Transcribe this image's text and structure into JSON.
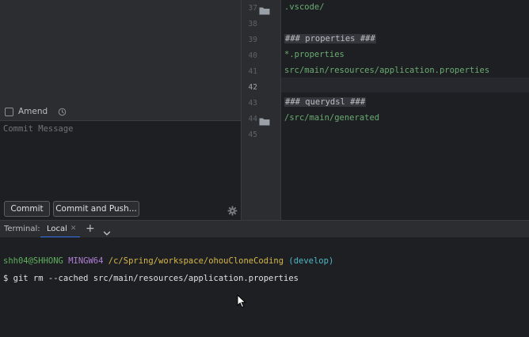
{
  "commit_panel": {
    "amend_label": "Amend",
    "message_placeholder": "Commit Message",
    "commit_button": "Commit",
    "commit_push_button": "Commit and Push..."
  },
  "editor": {
    "lines": [
      {
        "no": "37",
        "text": ".vscode/",
        "style": "green",
        "folder": true
      },
      {
        "no": "38",
        "text": "",
        "style": "green",
        "folder": false
      },
      {
        "no": "39",
        "text": "### properties ###",
        "style": "heading",
        "folder": false
      },
      {
        "no": "40",
        "text": "*.properties",
        "style": "green",
        "folder": false
      },
      {
        "no": "41",
        "text": "src/main/resources/application.properties",
        "style": "green",
        "folder": false
      },
      {
        "no": "42",
        "text": "",
        "style": "green",
        "folder": false
      },
      {
        "no": "43",
        "text": "### querydsl ###",
        "style": "heading",
        "folder": false
      },
      {
        "no": "44",
        "text": "/src/main/generated",
        "style": "green",
        "folder": true
      },
      {
        "no": "45",
        "text": "",
        "style": "green",
        "folder": false
      }
    ],
    "current_line": "42"
  },
  "terminal": {
    "title": "Terminal:",
    "tab_label": "Local",
    "prompt": {
      "user": "shh04@SHHONG",
      "host": "MINGW64",
      "path": "/c/Spring/workspace/ohouCloneCoding",
      "branch": "(develop)"
    },
    "command": "$ git rm --cached src/main/resources/application.properties"
  },
  "colors": {
    "accent": "#3574f0",
    "code_green": "#6aab73",
    "prompt_user": "#5fb05f",
    "prompt_host": "#b07fd6",
    "prompt_path": "#d7b84a",
    "prompt_branch": "#4fb7c7"
  },
  "icons": {
    "history": "clock-icon",
    "settings": "gear-icon",
    "folder": "folder-icon",
    "new_tab": "plus-icon",
    "tab_menu": "chevron-down-icon",
    "tab_close": "close-icon"
  }
}
